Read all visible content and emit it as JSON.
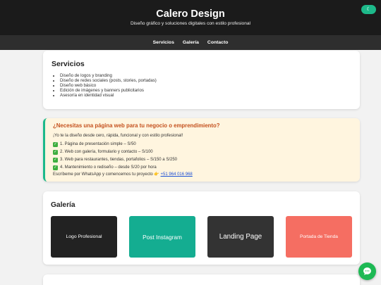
{
  "header": {
    "title": "Calero Design",
    "subtitle": "Diseño gráfico y soluciones digitales con estilo profesional",
    "toggle_icon": "☾"
  },
  "nav": {
    "items": [
      {
        "label": "Servicios"
      },
      {
        "label": "Galería"
      },
      {
        "label": "Contacto"
      }
    ]
  },
  "services": {
    "heading": "Servicios",
    "items": [
      "Diseño de logos y branding",
      "Diseño de redes sociales (posts, stories, portadas)",
      "Diseño web básico",
      "Edición de imágenes y banners publicitarios",
      "Asesoría en identidad visual"
    ]
  },
  "promo": {
    "heading": "¿Necesitas una página web para tu negocio o emprendimiento?",
    "intro": "¡Yo te la diseño desde cero, rápida, funcional y con estilo profesional!",
    "items": [
      "1. Página de presentación simple – S/50",
      "2. Web con galería, formulario y contacto – S/100",
      "3. Web para restaurantes, tiendas, portafolios – S/150 a S/250",
      "4. Mantenimiento o rediseño – desde S/20 por hora"
    ],
    "cta_text": "Escríbeme por WhatsApp y comencemos tu proyecto 👉",
    "cta_link": "+51 964 016 968"
  },
  "gallery": {
    "heading": "Galería",
    "tiles": [
      {
        "label": "Logo Profesional",
        "color": "#222222"
      },
      {
        "label": "Post Instagram",
        "color": "#14ad91"
      },
      {
        "label": "Landing Page",
        "color": "#333333"
      },
      {
        "label": "Portada de Tienda",
        "color": "#f56e62"
      }
    ]
  },
  "colors": {
    "accent": "#1db98a",
    "promo_heading": "#c4501d",
    "whatsapp": "#1db954"
  }
}
